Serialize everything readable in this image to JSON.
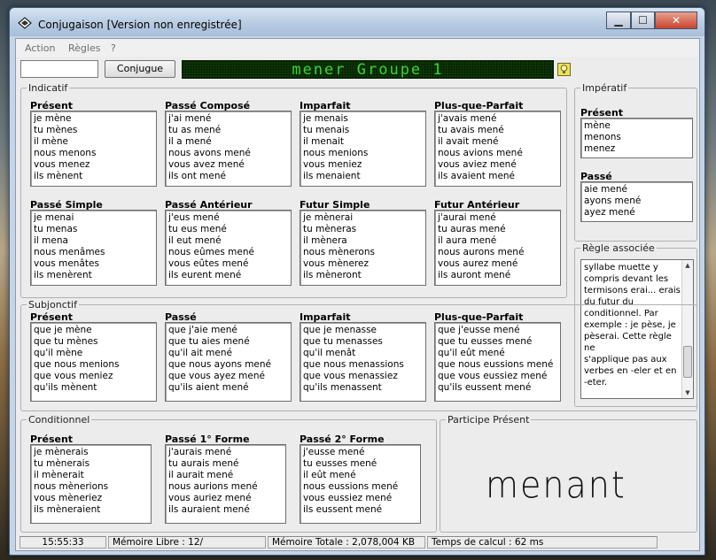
{
  "window": {
    "title": "Conjugaison [Version non enregistrée]",
    "minimize": "▁",
    "maximize": "☐",
    "close": "✕"
  },
  "menu": [
    "Action",
    "Règles",
    "?"
  ],
  "toolbar": {
    "input_value": "",
    "conjugue_label": "Conjugue",
    "display": "mener Groupe 1",
    "bulb_icon": "lightbulb-icon"
  },
  "indicatif": {
    "label": "Indicatif",
    "tenses": [
      {
        "name": "Présent",
        "forms": [
          "je mène",
          "tu mènes",
          "il mène",
          "nous menons",
          "vous menez",
          "ils mènent"
        ]
      },
      {
        "name": "Passé Composé",
        "forms": [
          "j'ai mené",
          "tu as mené",
          "il a mené",
          "nous avons mené",
          "vous avez mené",
          "ils ont mené"
        ]
      },
      {
        "name": "Imparfait",
        "forms": [
          "je menais",
          "tu menais",
          "il menait",
          "nous menions",
          "vous meniez",
          "ils menaient"
        ]
      },
      {
        "name": "Plus-que-Parfait",
        "forms": [
          "j'avais mené",
          "tu avais mené",
          "il avait mené",
          "nous avions mené",
          "vous aviez mené",
          "ils avaient mené"
        ]
      },
      {
        "name": "Passé Simple",
        "forms": [
          "je menai",
          "tu menas",
          "il mena",
          "nous menâmes",
          "vous menâtes",
          "ils menèrent"
        ]
      },
      {
        "name": "Passé Antérieur",
        "forms": [
          "j'eus mené",
          "tu eus mené",
          "il eut mené",
          "nous eûmes mené",
          "vous eûtes mené",
          "ils eurent mené"
        ]
      },
      {
        "name": "Futur Simple",
        "forms": [
          "je mènerai",
          "tu mèneras",
          "il mènera",
          "nous mènerons",
          "vous mènerez",
          "ils mèneront"
        ]
      },
      {
        "name": "Futur Antérieur",
        "forms": [
          "j'aurai mené",
          "tu auras mené",
          "il aura mené",
          "nous aurons mené",
          "vous aurez mené",
          "ils auront mené"
        ]
      }
    ]
  },
  "imperatif": {
    "label": "Impératif",
    "tenses": [
      {
        "name": "Présent",
        "forms": [
          "mène",
          "menons",
          "menez"
        ]
      },
      {
        "name": "Passé",
        "forms": [
          "aie mené",
          "ayons mené",
          "ayez mené"
        ]
      }
    ]
  },
  "regle": {
    "label": "Règle associée",
    "text": [
      "syllabe muette y",
      "compris devant les",
      "termisons erai... erais",
      "du futur du",
      "conditionnel. Par",
      "exemple : je pèse, je",
      "pèserai. Cette règle ne",
      "s'applique pas aux",
      "verbes en -eler et en",
      "-eter."
    ]
  },
  "subjonctif": {
    "label": "Subjonctif",
    "tenses": [
      {
        "name": "Présent",
        "forms": [
          "que je mène",
          "que tu mènes",
          "qu'il mène",
          "que nous menions",
          "que vous meniez",
          "qu'ils mènent"
        ]
      },
      {
        "name": "Passé",
        "forms": [
          "que j'aie mené",
          "que tu aies mené",
          "qu'il ait mené",
          "que nous ayons mené",
          "que vous ayez mené",
          "qu'ils aient mené"
        ]
      },
      {
        "name": "Imparfait",
        "forms": [
          "que je menasse",
          "que tu menasses",
          "qu'il menât",
          "que nous menassions",
          "que vous menassiez",
          "qu'ils menassent"
        ]
      },
      {
        "name": "Plus-que-Parfait",
        "forms": [
          "que j'eusse mené",
          "que tu eusses mené",
          "qu'il eût mené",
          "que nous eussions mené",
          "que vous eussiez mené",
          "qu'ils eussent mené"
        ]
      }
    ]
  },
  "conditionnel": {
    "label": "Conditionnel",
    "tenses": [
      {
        "name": "Présent",
        "forms": [
          "je mènerais",
          "tu mènerais",
          "il mènerait",
          "nous mènerions",
          "vous mèneriez",
          "ils mèneraient"
        ]
      },
      {
        "name": "Passé 1° Forme",
        "forms": [
          "j'aurais mené",
          "tu aurais mené",
          "il aurait mené",
          "nous aurions mené",
          "vous auriez mené",
          "ils auraient mené"
        ]
      },
      {
        "name": "Passé 2° Forme",
        "forms": [
          "j'eusse mené",
          "tu eusses mené",
          "il eût mené",
          "nous eussions mené",
          "vous eussiez mené",
          "ils eussent mené"
        ]
      }
    ]
  },
  "participe": {
    "label": "Participe Présent",
    "value": "menant"
  },
  "status": {
    "time": "15:55:33",
    "memoire_libre": "Mémoire Libre : 12/",
    "memoire_totale": "Mémoire Totale : 2,078,004 KB",
    "temps": "Temps de calcul : 62 ms"
  }
}
